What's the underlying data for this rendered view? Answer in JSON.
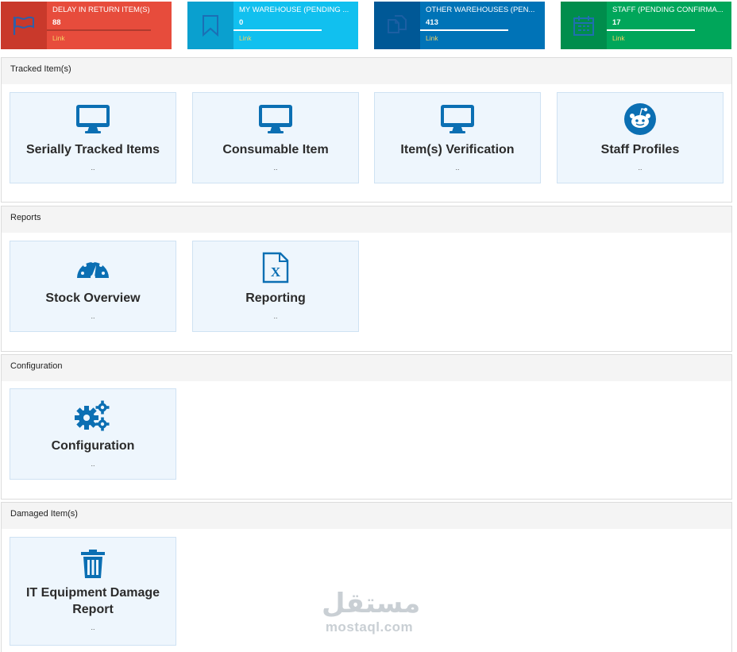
{
  "stats": [
    {
      "title": "DELAY IN RETURN ITEM(S)",
      "count": "88",
      "link": "Link",
      "icon": "flag-icon",
      "progress": 1.0
    },
    {
      "title": "MY WAREHOUSE (PENDING ...",
      "count": "0",
      "link": "Link",
      "icon": "bookmark-icon",
      "progress": 0.85
    },
    {
      "title": "OTHER WAREHOUSES (PEN...",
      "count": "413",
      "link": "Link",
      "icon": "copy-icon",
      "progress": 0.85
    },
    {
      "title": "STAFF (PENDING CONFIRMA...",
      "count": "17",
      "link": "Link",
      "icon": "calendar-icon",
      "progress": 0.85
    }
  ],
  "sections": [
    {
      "header": "Tracked Item(s)",
      "tiles": [
        {
          "label": "Serially Tracked Items",
          "sub": "..",
          "icon": "monitor-icon"
        },
        {
          "label": "Consumable Item",
          "sub": "..",
          "icon": "monitor-icon"
        },
        {
          "label": "Item(s) Verification",
          "sub": "..",
          "icon": "monitor-icon"
        },
        {
          "label": "Staff Profiles",
          "sub": "..",
          "icon": "reddit-icon"
        }
      ]
    },
    {
      "header": "Reports",
      "tiles": [
        {
          "label": "Stock Overview",
          "sub": "..",
          "icon": "dashboard-gauge-icon"
        },
        {
          "label": "Reporting",
          "sub": "..",
          "icon": "excel-file-icon"
        }
      ]
    },
    {
      "header": "Configuration",
      "tiles": [
        {
          "label": "Configuration",
          "sub": "..",
          "icon": "gears-icon"
        }
      ]
    },
    {
      "header": "Damaged Item(s)",
      "tiles": [
        {
          "label": "IT Equipment Damage Report",
          "sub": "..",
          "icon": "trash-icon"
        }
      ]
    }
  ],
  "watermark": {
    "arabic": "مستقل",
    "latin": "mostaql.com"
  },
  "colors": {
    "red": "#e74c3c",
    "aqua": "#11c0ef",
    "blue": "#0073b7",
    "green": "#00a65a",
    "tile_bg": "#eef6fd",
    "icon_blue": "#0b6fb3"
  }
}
